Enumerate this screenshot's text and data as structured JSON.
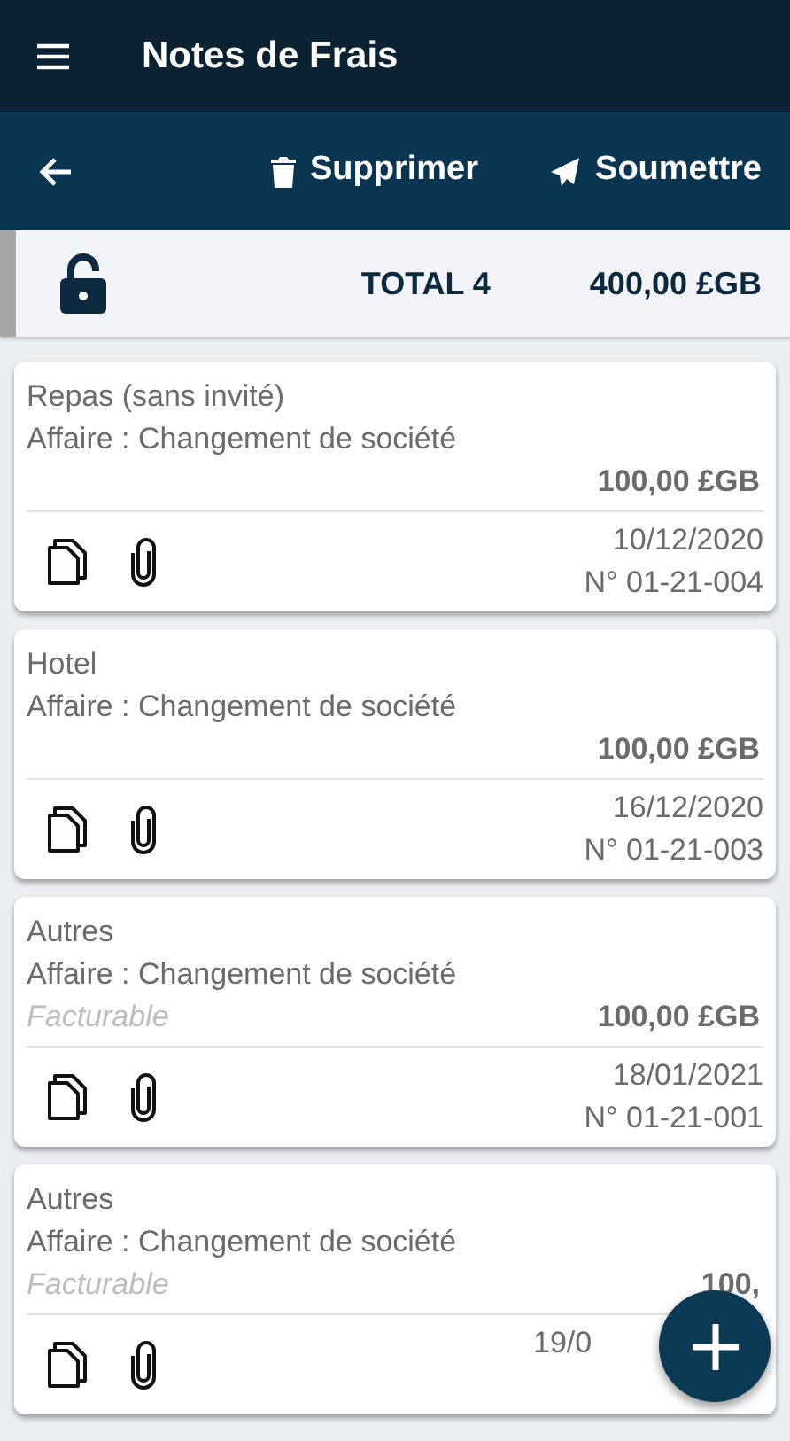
{
  "app_bar": {
    "title": "Notes de Frais"
  },
  "toolbar": {
    "actions": [
      {
        "kind": "delete",
        "label": "Supprimer"
      },
      {
        "kind": "submit",
        "label": "Soumettre"
      }
    ]
  },
  "summary": {
    "locked": false,
    "total": "TOTAL 4",
    "amount": "400,00 £GB"
  },
  "expenses": [
    {
      "category": "Repas (sans invité)",
      "affair": "Affaire : Changement de société",
      "amount": "100,00 £GB",
      "date": "10/12/2020",
      "number": "N° 01-21-004"
    },
    {
      "category": "Hotel",
      "affair": "Affaire : Changement de société",
      "amount": "100,00 £GB",
      "date": "16/12/2020",
      "number": "N° 01-21-003"
    },
    {
      "category": "Autres",
      "affair": "Affaire : Changement de société",
      "billable": "Facturable",
      "amount": "100,00 £GB",
      "date": "18/01/2021",
      "number": "N° 01-21-001"
    },
    {
      "category": "Autres",
      "affair": "Affaire : Changement de société",
      "billable": "Facturable",
      "amount": "100,",
      "date": "19/0"
    }
  ]
}
